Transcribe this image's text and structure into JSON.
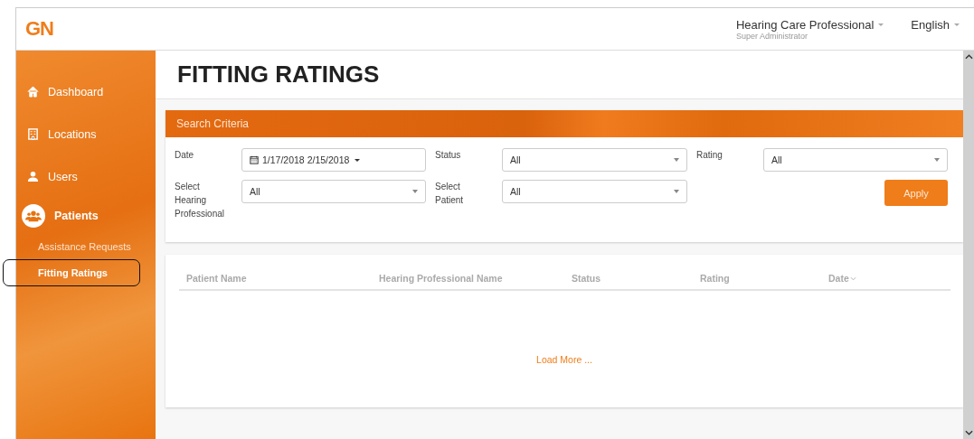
{
  "header": {
    "logo": "GN",
    "user_name": "Hearing Care Professional",
    "user_role": "Super Administrator",
    "language": "English"
  },
  "sidebar": {
    "items": [
      {
        "kind": "main",
        "label": "Dashboard",
        "selected": false
      },
      {
        "kind": "main",
        "label": "Locations",
        "selected": false
      },
      {
        "kind": "main",
        "label": "Users",
        "selected": false
      },
      {
        "kind": "group",
        "label": "Patients",
        "selected": false
      },
      {
        "kind": "sub",
        "label": "Assistance Requests",
        "selected": false
      },
      {
        "kind": "sub",
        "label": "Fitting Ratings",
        "selected": true
      }
    ]
  },
  "page_title": "FITTING RATINGS",
  "search_criteria": {
    "title": "Search Criteria",
    "filters": [
      {
        "kind": "date",
        "label": "Date",
        "value": "1/17/2018 2/15/2018"
      },
      {
        "kind": "select",
        "label": "Status",
        "value": "All"
      },
      {
        "kind": "select",
        "label": "Rating",
        "value": "All"
      },
      {
        "kind": "select",
        "label": "Select Hearing Professional",
        "value": "All"
      },
      {
        "kind": "select",
        "label": "Select Patient",
        "value": "All"
      }
    ],
    "apply_button": "Apply"
  },
  "table": {
    "columns": [
      {
        "label": "Patient Name",
        "sorted": false
      },
      {
        "label": "Hearing Professional Name",
        "sorted": false
      },
      {
        "label": "Status",
        "sorted": false
      },
      {
        "label": "Rating",
        "sorted": false
      },
      {
        "label": "Date",
        "sorted": true
      }
    ],
    "load_more": "Load More ..."
  }
}
